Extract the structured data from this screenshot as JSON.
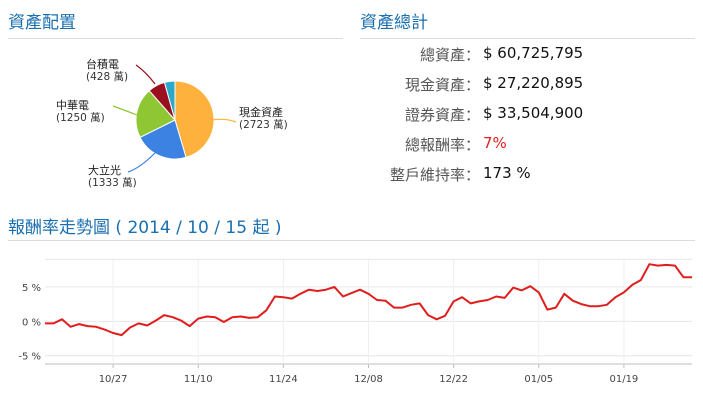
{
  "sections": {
    "allocation_title": "資產配置",
    "totals_title": "資產總計",
    "trend_title": "報酬率走勢圖 ( 2014 / 10 / 15 起 )"
  },
  "totals": [
    {
      "label": "總資產：",
      "value": "$ 60,725,795"
    },
    {
      "label": "現金資產：",
      "value": "$ 27,220,895"
    },
    {
      "label": "證券資產：",
      "value": "$ 33,504,900"
    },
    {
      "label": "總報酬率：",
      "value": "7%",
      "color": "#e01e1e"
    },
    {
      "label": "整戶維持率：",
      "value": "173 %"
    }
  ],
  "chart_data": [
    {
      "type": "pie",
      "slices": [
        {
          "name": "現金資產",
          "value_label": "(2723 萬)",
          "value": 2723,
          "color": "#ffb13d"
        },
        {
          "name": "大立光",
          "value_label": "(1333 萬)",
          "value": 1333,
          "color": "#3b82e3"
        },
        {
          "name": "中華電",
          "value_label": "(1250 萬)",
          "value": 1250,
          "color": "#8fc634"
        },
        {
          "name": "台積電",
          "value_label": "(428 萬)",
          "value": 428,
          "color": "#9b1020"
        },
        {
          "name": "",
          "value": 260,
          "color": "#2aa9c9"
        }
      ]
    },
    {
      "type": "line",
      "title": "報酬率走勢圖 ( 2014 / 10 / 15 起 )",
      "y_ticks": [
        "5 %",
        "0 %",
        "-5 %"
      ],
      "ylim": [
        -6.2,
        9.2
      ],
      "x_ticks": [
        "10/27",
        "11/10",
        "11/24",
        "12/08",
        "12/22",
        "01/05",
        "01/19"
      ],
      "x_tick_index": [
        8,
        18,
        28,
        38,
        48,
        58,
        68
      ],
      "grid": true,
      "color": "#e01e1e",
      "values": [
        -0.3,
        -0.3,
        0.3,
        -0.8,
        -0.4,
        -0.7,
        -0.8,
        -1.2,
        -1.7,
        -2.0,
        -0.9,
        -0.3,
        -0.6,
        0.1,
        0.9,
        0.6,
        0.1,
        -0.7,
        0.4,
        0.7,
        0.6,
        -0.1,
        0.6,
        0.7,
        0.5,
        0.6,
        1.6,
        3.6,
        3.5,
        3.3,
        4.0,
        4.6,
        4.4,
        4.6,
        5.0,
        3.6,
        4.1,
        4.6,
        4.0,
        3.1,
        3.0,
        2.0,
        2.0,
        2.4,
        2.6,
        0.9,
        0.3,
        0.8,
        2.9,
        3.5,
        2.6,
        2.9,
        3.1,
        3.6,
        3.4,
        4.9,
        4.5,
        5.1,
        4.2,
        1.7,
        2.0,
        4.0,
        3.0,
        2.5,
        2.2,
        2.2,
        2.4,
        3.5,
        4.2,
        5.3,
        6.0,
        8.3,
        8.1,
        8.2,
        8.1,
        6.4,
        6.4
      ]
    }
  ]
}
